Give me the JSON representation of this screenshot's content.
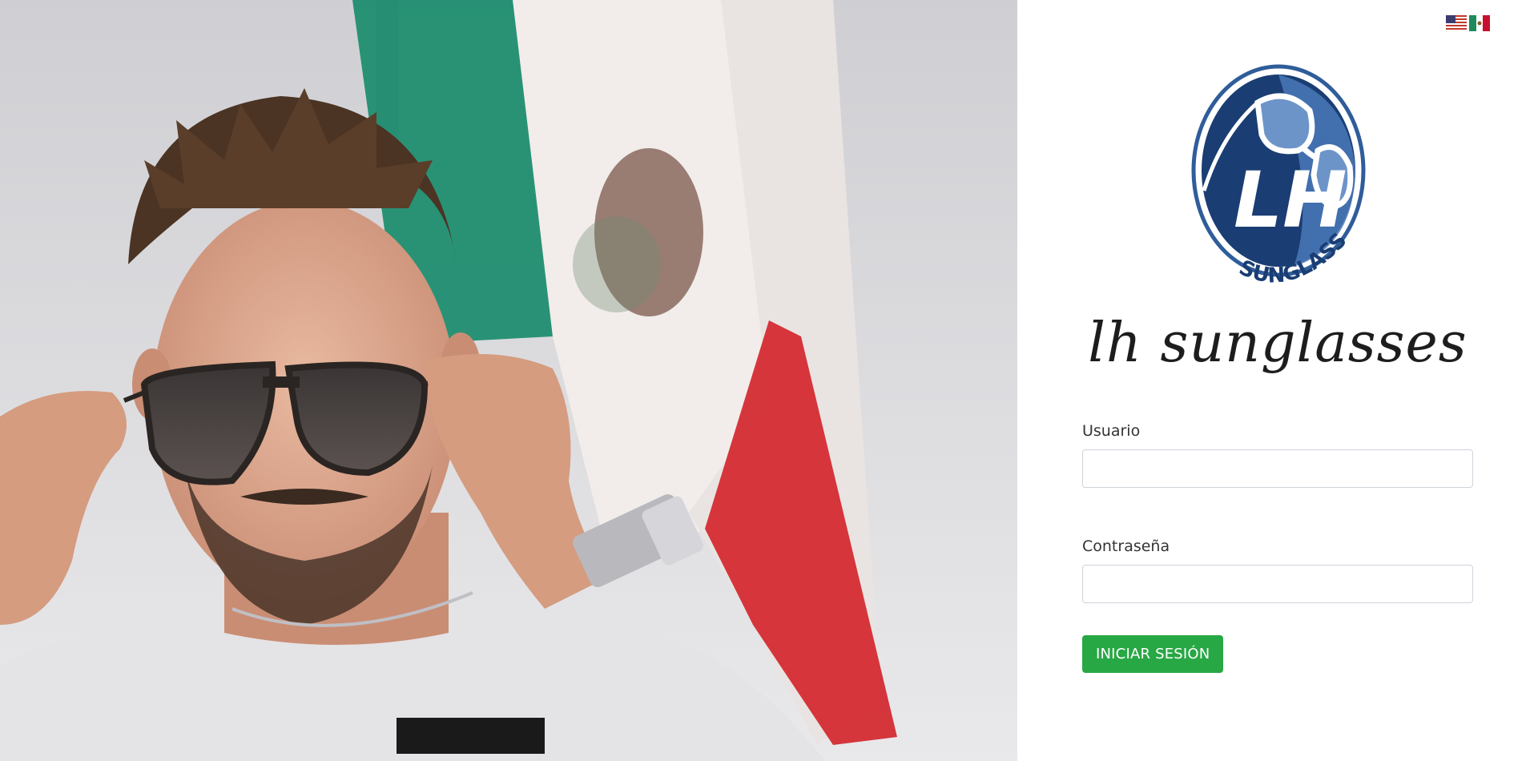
{
  "hero": {
    "description_icon": "person-with-sunglasses-photo"
  },
  "language_switch": {
    "options": [
      {
        "code": "en",
        "icon": "us-flag-icon"
      },
      {
        "code": "es",
        "icon": "mexico-flag-icon"
      }
    ]
  },
  "logo": {
    "monogram": "LH",
    "text": "SUNGLASSES"
  },
  "brand": {
    "title": "lh sunglasses"
  },
  "login_form": {
    "username_label": "Usuario",
    "username_value": "",
    "password_label": "Contraseña",
    "password_value": "",
    "submit_label": "INICIAR SESIÓN"
  },
  "colors": {
    "primary_button": "#28a745",
    "logo_blue": "#2f5d9a",
    "logo_dark_blue": "#1a3d73"
  }
}
